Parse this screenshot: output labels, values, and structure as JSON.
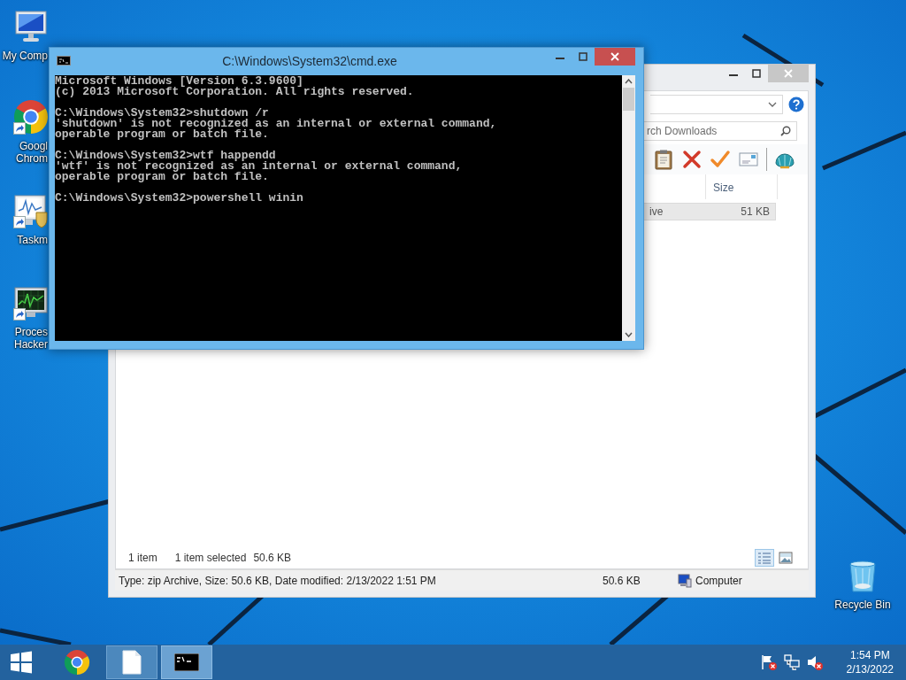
{
  "desktop": {
    "icons": [
      {
        "kind": "computer",
        "shortcut": false,
        "lines": [
          "My Comp"
        ]
      },
      {
        "kind": "chrome",
        "shortcut": true,
        "lines": [
          "Googl",
          "Chrom"
        ]
      },
      {
        "kind": "taskmgr",
        "shortcut": true,
        "lines": [
          "Taskm"
        ]
      },
      {
        "kind": "hacker",
        "shortcut": true,
        "lines": [
          "Proces",
          "Hacker"
        ]
      },
      {
        "kind": "recycle",
        "shortcut": false,
        "lines": [
          "Recycle Bin"
        ]
      }
    ]
  },
  "explorer": {
    "search": {
      "placeholder": "rch Downloads"
    },
    "toolbar": [
      {
        "kind": "clipboard"
      },
      {
        "kind": "delete"
      },
      {
        "kind": "check"
      },
      {
        "kind": "card"
      },
      {
        "kind": "shell"
      }
    ],
    "columns": [
      "Size"
    ],
    "rows": [
      {
        "cells": [
          "ive",
          "51 KB"
        ],
        "selected": true
      }
    ],
    "status": [
      "1 item",
      "1 item selected",
      "50.6 KB"
    ],
    "views": [
      {
        "kind": "details",
        "selected": true
      },
      {
        "kind": "tiles",
        "selected": false
      }
    ],
    "details": {
      "info": "Type: zip Archive, Size: 50.6 KB, Date modified: 2/13/2022 1:51 PM",
      "size": "50.6 KB",
      "location": "Computer"
    }
  },
  "console": {
    "title": "C:\\Windows\\System32\\cmd.exe",
    "blocks": [
      [
        "Microsoft Windows [Version 6.3.9600]",
        "(c) 2013 Microsoft Corporation. All rights reserved."
      ],
      [
        "C:\\Windows\\System32>shutdown /r",
        "'shutdown' is not recognized as an internal or external command,",
        "operable program or batch file."
      ],
      [
        "C:\\Windows\\System32>wtf happendd",
        "'wtf' is not recognized as an internal or external command,",
        "operable program or batch file."
      ],
      [
        "C:\\Windows\\System32>powershell winin"
      ]
    ]
  },
  "taskbar": {
    "buttons": [
      {
        "kind": "chrome",
        "running": false,
        "active": false
      },
      {
        "kind": "explorer",
        "running": true,
        "active": false
      },
      {
        "kind": "cmd",
        "running": true,
        "active": true
      }
    ],
    "tray": [
      {
        "kind": "flag",
        "alert": true
      },
      {
        "kind": "network",
        "alert": false
      },
      {
        "kind": "volume",
        "alert": true
      }
    ],
    "clock": {
      "time": "1:54 PM",
      "date": "2/13/2022"
    }
  }
}
